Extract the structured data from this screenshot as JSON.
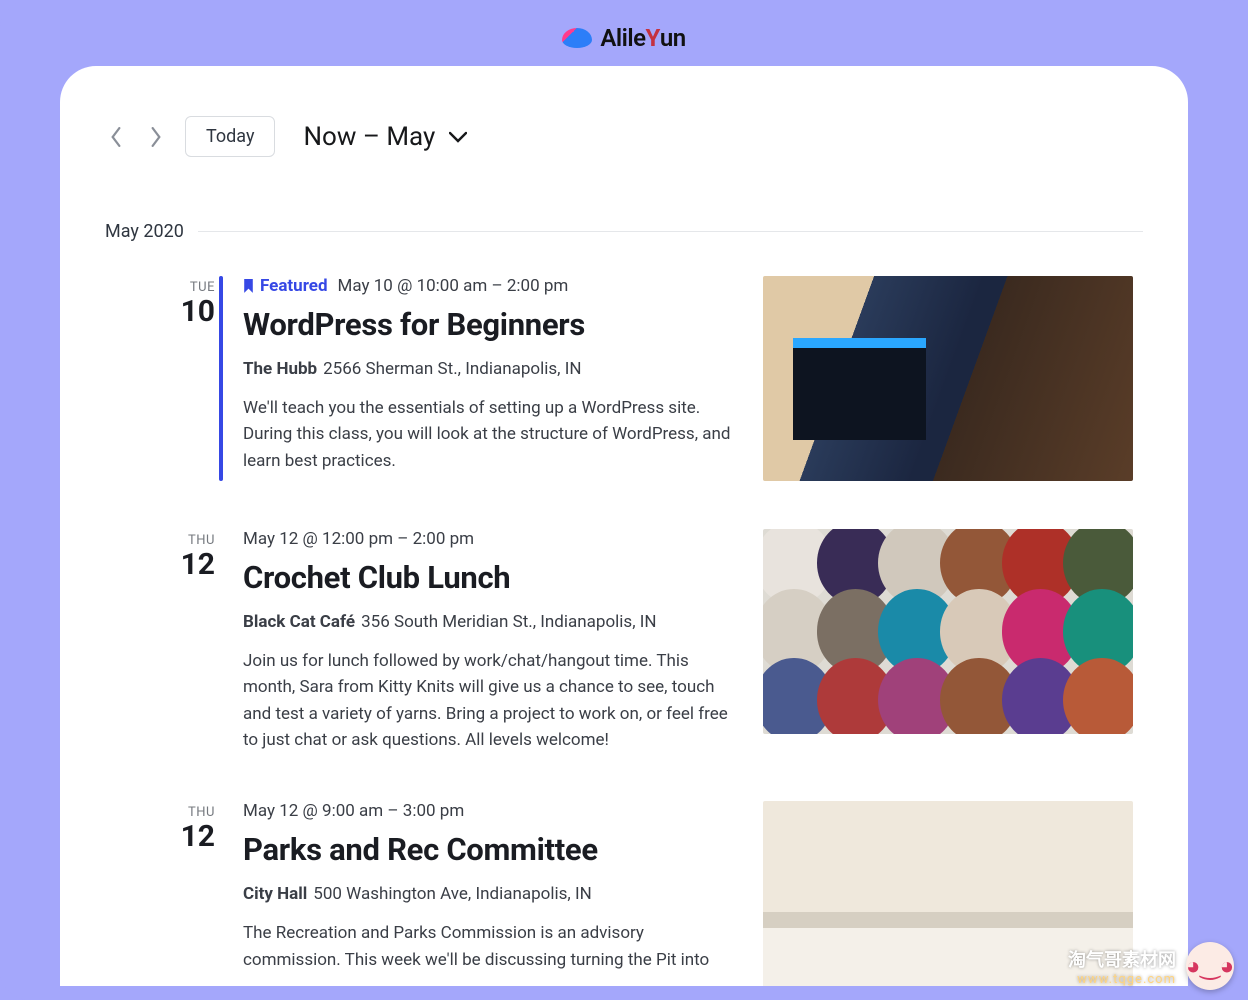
{
  "logo": {
    "text": "Alile",
    "accent": "Y",
    "suffix": "un"
  },
  "toolbar": {
    "today_label": "Today",
    "range_label": "Now – May"
  },
  "month_heading": "May 2020",
  "events": [
    {
      "dow": "TUE",
      "day": "10",
      "featured_label": "Featured",
      "datetime": "May 10 @ 10:00 am – 2:00 pm",
      "title": "WordPress for Beginners",
      "venue": "The Hubb",
      "address": "2566 Sherman St., Indianapolis, IN",
      "description": "We'll teach you the essentials of setting up a WordPress site. During this class, you will look at the structure of WordPress, and learn best practices.",
      "featured": true
    },
    {
      "dow": "THU",
      "day": "12",
      "datetime": "May 12 @ 12:00 pm – 2:00 pm",
      "title": "Crochet Club Lunch",
      "venue": "Black Cat Café",
      "address": "356 South Meridian St., Indianapolis, IN",
      "description": "Join us for lunch followed by work/chat/hangout time. This month, Sara from Kitty Knits will give us a chance to see, touch and test a variety of yarns. Bring a project to work on, or feel free to just chat or ask questions. All levels welcome!",
      "featured": false
    },
    {
      "dow": "THU",
      "day": "12",
      "datetime": "May 12 @ 9:00 am – 3:00 pm",
      "title": "Parks and Rec Committee",
      "venue": "City Hall",
      "address": "500 Washington Ave, Indianapolis, IN",
      "description": "The Recreation and Parks Commission is an advisory commission. This week we'll be discussing turning the Pit into",
      "featured": false
    }
  ],
  "watermark": {
    "title": "淘气哥素材网",
    "url": "www.tqge.com"
  },
  "yarn_colors": [
    "#e8e3dd",
    "#392c56",
    "#d0c8bc",
    "#935738",
    "#ae3028",
    "#4a5a3a",
    "#d6cfc4",
    "#7b6f63",
    "#1a8aa8",
    "#d8c9b8",
    "#c92a6e",
    "#18907c",
    "#4a5a8f",
    "#ae3a3a",
    "#a0417a",
    "#935738",
    "#5a3d90",
    "#b85a38"
  ]
}
